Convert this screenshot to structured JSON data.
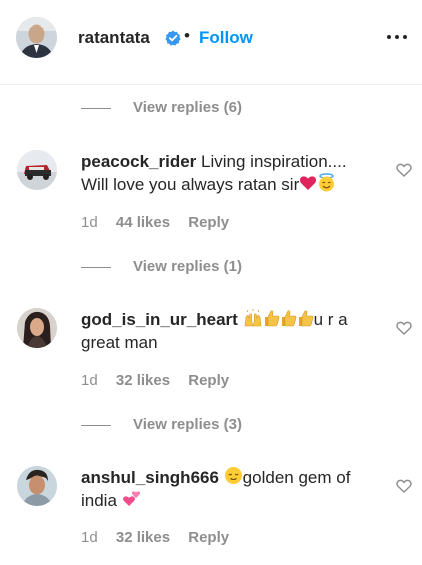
{
  "header": {
    "username": "ratantata",
    "separator": "•",
    "follow_label": "Follow"
  },
  "replies_top": {
    "label": "View replies (6)"
  },
  "comments": [
    {
      "username": "peacock_rider",
      "text_before": "Living inspiration.... Will love you always ratan sir",
      "text_after": "",
      "emoji_names": [
        "red-heart",
        "smiling-face-with-halo"
      ],
      "time": "1d",
      "likes": "44 likes",
      "reply": "Reply",
      "view_replies": "View replies (1)"
    },
    {
      "username": "god_is_in_ur_heart",
      "text_before": "",
      "text_after": "u r a great man",
      "emoji_names": [
        "raising-hands",
        "thumbs-up",
        "thumbs-up",
        "thumbs-up"
      ],
      "time": "1d",
      "likes": "32 likes",
      "reply": "Reply",
      "view_replies": "View replies (3)"
    },
    {
      "username": "anshul_singh666",
      "text_before": "",
      "text_mid": "golden gem of india",
      "emoji_names": [
        "relieved-face",
        "two-hearts"
      ],
      "time": "1d",
      "likes": "32 likes",
      "reply": "Reply"
    }
  ],
  "colors": {
    "text": "#262626",
    "muted": "#8e8e8e",
    "link": "#0095f6",
    "verified": "#3897f0"
  }
}
